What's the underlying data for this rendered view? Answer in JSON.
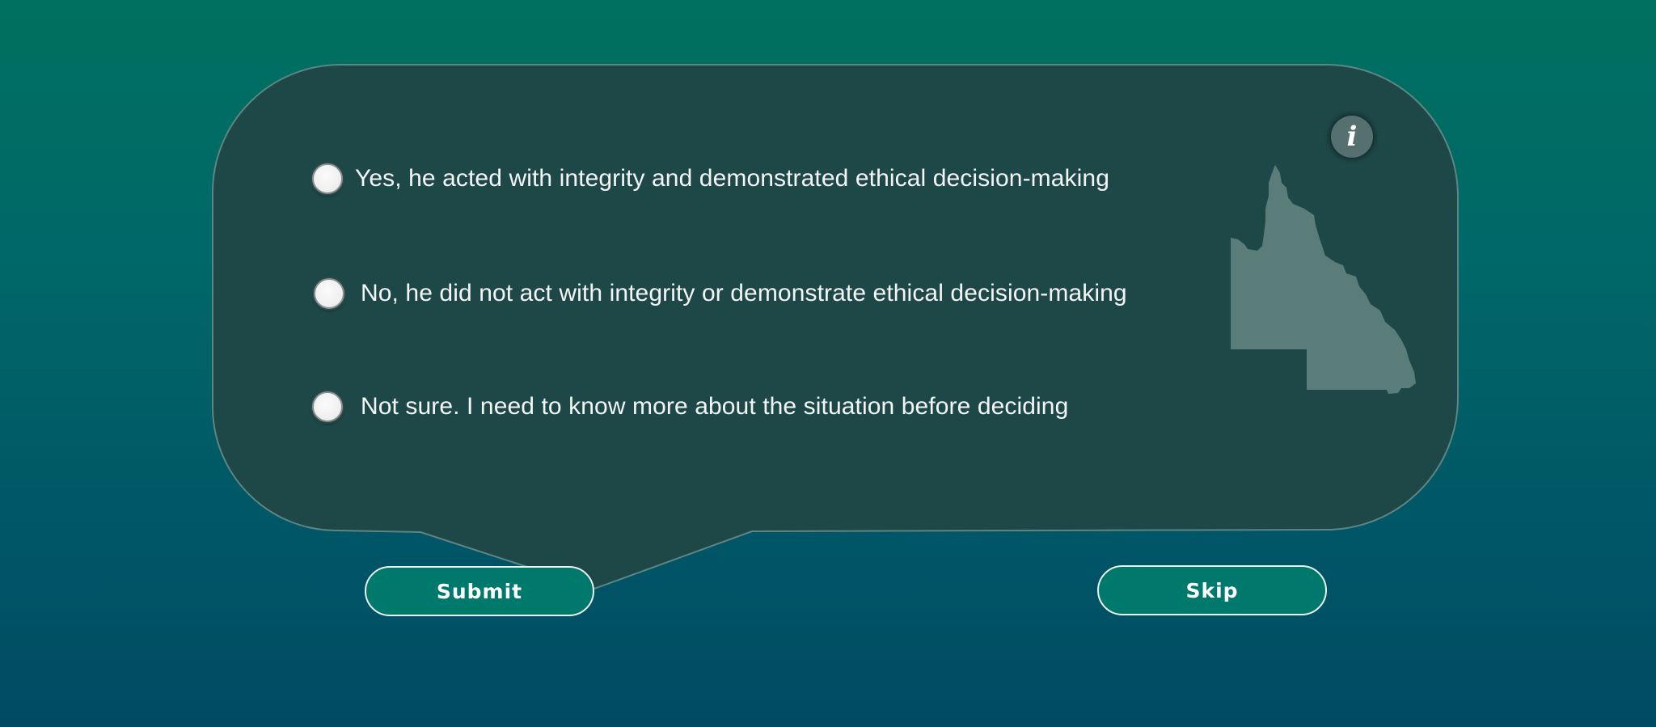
{
  "question": {
    "options": [
      {
        "label": "Yes, he acted with integrity and demonstrated ethical decision-making",
        "selected": false
      },
      {
        "label": "No, he did not act with integrity or demonstrate ethical decision-making",
        "selected": false
      },
      {
        "label": "Not sure. I need to know more about the situation before deciding",
        "selected": false
      }
    ]
  },
  "actions": {
    "submit_label": "Submit",
    "skip_label": "Skip"
  },
  "info": {
    "icon": "info-icon",
    "glyph": "i"
  },
  "decoration": {
    "map_icon": "queensland-map-icon"
  },
  "colors": {
    "background_top": "#00705f",
    "background_bottom": "#004b63",
    "bubble_fill": "#1e4848",
    "bubble_border": "#5e8584",
    "button_fill": "#00796d",
    "map_fill": "#5a7d79"
  }
}
